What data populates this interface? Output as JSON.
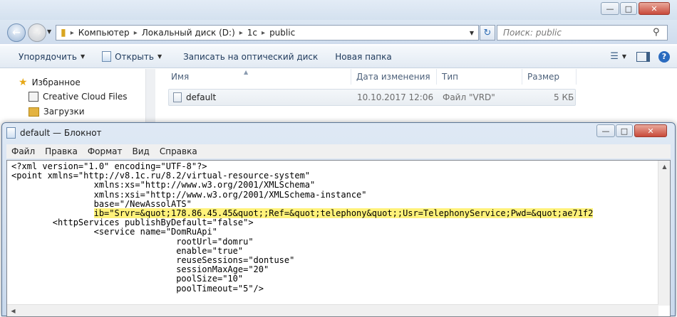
{
  "explorer": {
    "address": {
      "segments": [
        "Компьютер",
        "Локальный диск (D:)",
        "1c",
        "public"
      ]
    },
    "search_placeholder": "Поиск: public",
    "toolbar": {
      "organize": "Упорядочить",
      "open": "Открыть",
      "burn": "Записать на оптический диск",
      "new_folder": "Новая папка"
    },
    "sidebar": {
      "items": [
        {
          "label": "Избранное",
          "icon": "star-icon"
        },
        {
          "label": "Creative Cloud Files",
          "icon": "cloud-folder-icon"
        },
        {
          "label": "Загрузки",
          "icon": "downloads-folder-icon"
        }
      ]
    },
    "columns": [
      "Имя",
      "Дата изменения",
      "Тип",
      "Размер"
    ],
    "files": [
      {
        "name": "default",
        "modified": "10.10.2017 12:06",
        "type": "Файл \"VRD\"",
        "size": "5 КБ"
      }
    ]
  },
  "notepad": {
    "title": "default — Блокнот",
    "menu": [
      "Файл",
      "Правка",
      "Формат",
      "Вид",
      "Справка"
    ],
    "lines": {
      "l1": "<?xml version=\"1.0\" encoding=\"UTF-8\"?>",
      "l2": "<point xmlns=\"http://v8.1c.ru/8.2/virtual-resource-system\"",
      "l3": "                xmlns:xs=\"http://www.w3.org/2001/XMLSchema\"",
      "l4": "                xmlns:xsi=\"http://www.w3.org/2001/XMLSchema-instance\"",
      "l5": "                base=\"/NewAssolATS\"",
      "l6_prefix": "                ",
      "l6_highlight": "ib=\"Srvr=&quot;178.86.45.45&quot;;Ref=&quot;telephony&quot;;Usr=TelephonyService;Pwd=&quot;ae71f2",
      "l7": "        <httpServices publishByDefault=\"false\">",
      "l8": "                <service name=\"DomRuApi\"",
      "l9": "                                rootUrl=\"domru\"",
      "l10": "                                enable=\"true\"",
      "l11": "                                reuseSessions=\"dontuse\"",
      "l12": "                                sessionMaxAge=\"20\"",
      "l13": "                                poolSize=\"10\"",
      "l14": "                                poolTimeout=\"5\"/>"
    }
  }
}
